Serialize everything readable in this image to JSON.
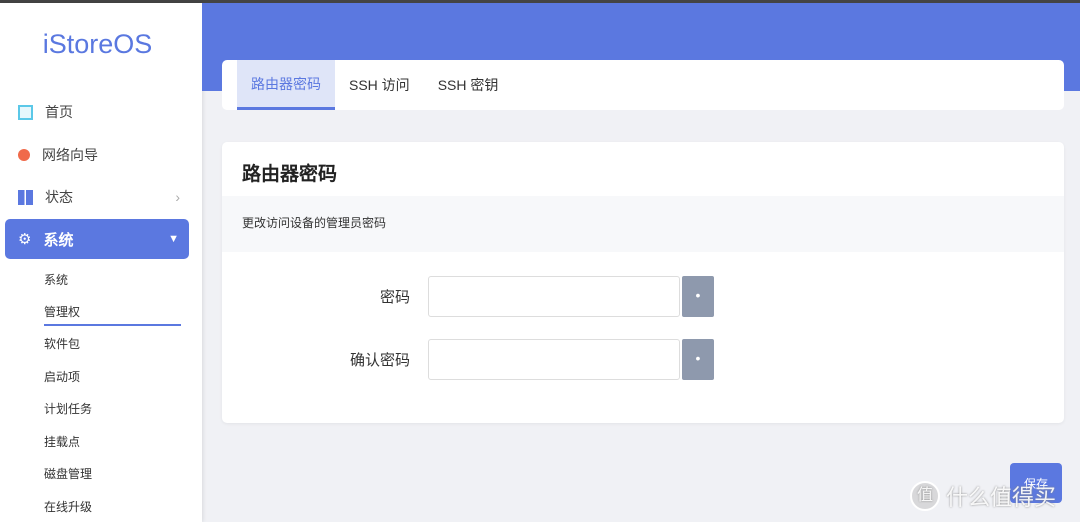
{
  "app": {
    "logo": "iStoreOS"
  },
  "sidebar": {
    "items": [
      {
        "label": "首页"
      },
      {
        "label": "网络向导"
      },
      {
        "label": "状态"
      },
      {
        "label": "系统"
      }
    ],
    "sub": [
      "系统",
      "管理权",
      "软件包",
      "启动项",
      "计划任务",
      "挂载点",
      "磁盘管理",
      "在线升级"
    ]
  },
  "tabs": [
    "路由器密码",
    "SSH 访问",
    "SSH 密钥"
  ],
  "card": {
    "title": "路由器密码",
    "description": "更改访问设备的管理员密码",
    "password_label": "密码",
    "confirm_label": "确认密码",
    "password_value": "",
    "confirm_value": "",
    "reveal": "•"
  },
  "save_label": "保存",
  "watermark": {
    "icon": "值",
    "text": "什么值得买"
  },
  "colors": {
    "accent": "#5b78e0"
  }
}
